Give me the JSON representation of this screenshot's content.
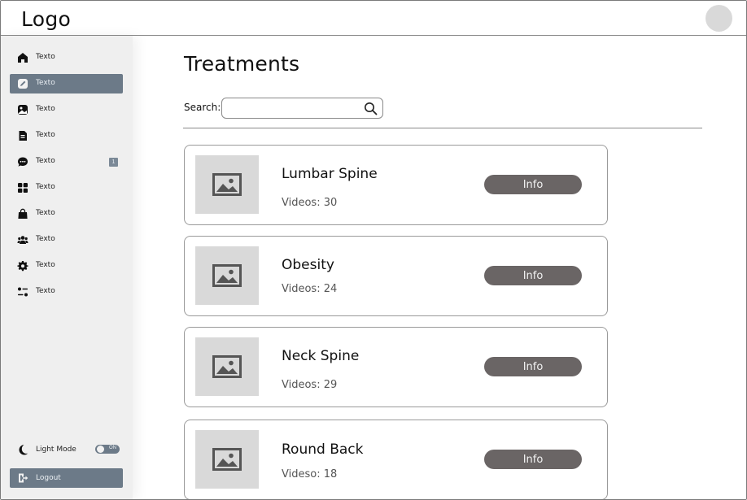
{
  "header": {
    "logo": "Logo"
  },
  "sidebar": {
    "items": [
      {
        "label": "Texto",
        "icon": "home-icon"
      },
      {
        "label": "Texto",
        "icon": "edit-icon",
        "active": true
      },
      {
        "label": "Texto",
        "icon": "image-icon"
      },
      {
        "label": "Texto",
        "icon": "document-icon"
      },
      {
        "label": "Texto",
        "icon": "chat-icon",
        "badge": "1"
      },
      {
        "label": "Texto",
        "icon": "grid-icon"
      },
      {
        "label": "Texto",
        "icon": "bag-icon"
      },
      {
        "label": "Texto",
        "icon": "users-icon"
      },
      {
        "label": "Texto",
        "icon": "gear-icon"
      },
      {
        "label": "Texto",
        "icon": "sliders-icon"
      }
    ],
    "mode": {
      "label": "Light Mode",
      "toggle_text": "ON",
      "icon": "moon-icon"
    },
    "logout": {
      "label": "Logout",
      "icon": "logout-icon"
    },
    "accent": "#6c7a88"
  },
  "main": {
    "title": "Treatments",
    "search": {
      "label": "Search:",
      "value": "",
      "placeholder": ""
    },
    "cards": [
      {
        "title": "Lumbar Spine",
        "subtitle": "Videos: 30",
        "button": "Info"
      },
      {
        "title": "Obesity",
        "subtitle": "Videos: 24",
        "button": "Info"
      },
      {
        "title": "Neck Spine",
        "subtitle": "Videos: 29",
        "button": "Info"
      },
      {
        "title": "Round Back",
        "subtitle": "Videso: 18",
        "button": "Info"
      }
    ]
  }
}
